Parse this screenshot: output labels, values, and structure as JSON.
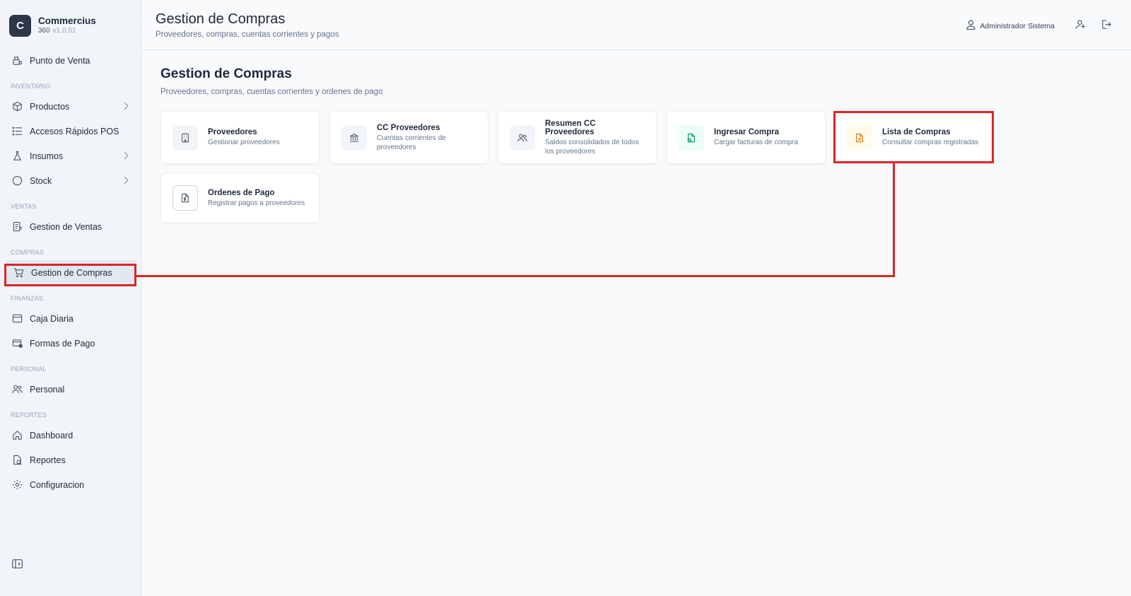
{
  "brand": {
    "logo_letter": "C",
    "name": "Commercius",
    "sub": "360",
    "version": "v1.0.51"
  },
  "sidebar": {
    "items": [
      {
        "label": "Punto de Venta"
      },
      {
        "section": "INVENTARIO"
      },
      {
        "label": "Productos"
      },
      {
        "label": "Accesos Rápidos POS"
      },
      {
        "label": "Insumos"
      },
      {
        "label": "Stock"
      },
      {
        "section": "VENTAS"
      },
      {
        "label": "Gestion de Ventas"
      },
      {
        "section": "COMPRAS"
      },
      {
        "label": "Gestion de Compras",
        "active": true
      },
      {
        "section": "FINANZAS"
      },
      {
        "label": "Caja Diaria"
      },
      {
        "label": "Formas de Pago"
      },
      {
        "section": "PERSONAL"
      },
      {
        "label": "Personal"
      },
      {
        "section": "REPORTES"
      },
      {
        "label": "Dashboard"
      },
      {
        "label": "Reportes"
      },
      {
        "label": "Configuracion"
      }
    ]
  },
  "header": {
    "title": "Gestion de Compras",
    "subtitle": "Proveedores, compras, cuentas corrientes y pagos",
    "user_name": "Administrador Sistema"
  },
  "main": {
    "title": "Gestion de Compras",
    "subtitle": "Proveedores, compras, cuentas corrientes y ordenes de pago",
    "cards": [
      {
        "title": "Proveedores",
        "desc": "Gestionar proveedores",
        "icon": "building-icon"
      },
      {
        "title": "CC Proveedores",
        "desc": "Cuentas corrientes de proveedores",
        "icon": "bank-icon"
      },
      {
        "title": "Resumen CC Proveedores",
        "desc": "Saldos consolidados de todos los proveedores",
        "icon": "users-icon"
      },
      {
        "title": "Ingresar Compra",
        "desc": "Cargar facturas de compra",
        "icon": "file-add-icon"
      },
      {
        "title": "Lista de Compras",
        "desc": "Consultar compras registradas",
        "icon": "file-list-icon"
      },
      {
        "title": "Ordenes de Pago",
        "desc": "Registrar pagos a proveedores",
        "icon": "payment-order-icon"
      }
    ]
  },
  "colors": {
    "annotation": "#dc2626",
    "sidebar_bg": "#f1f5f9",
    "accent_dark": "#2d3748"
  }
}
